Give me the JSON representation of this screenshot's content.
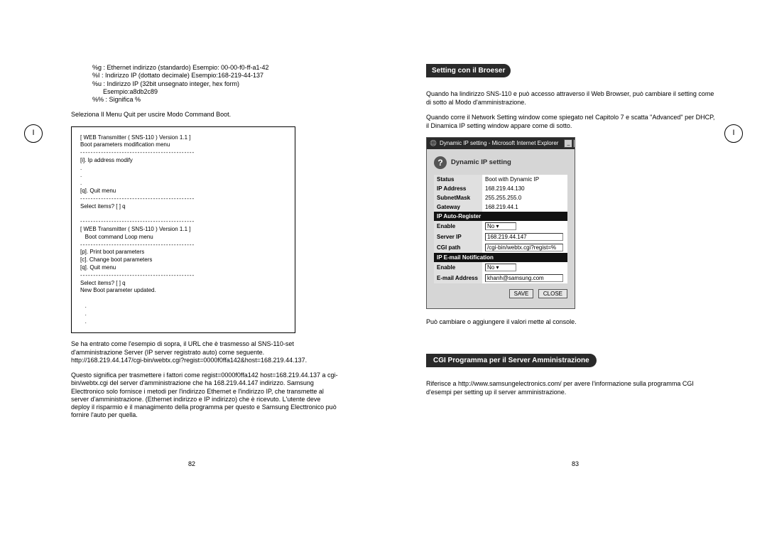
{
  "left": {
    "percent_lines": [
      "%g : Ethernet indirizzo (standardo) Esempio: 00-00-f0-ff-a1-42",
      "%I  : Indirizzo IP (dottato decimale) Esempio:168-219-44-137",
      "%u : Indirizzo IP (32bit unsegnato integer, hex form)",
      "      Esempio:a8db2c89",
      "%% : Significa %"
    ],
    "select_menu": "Seleziona Il Menu Quit per uscire Modo Command Boot.",
    "box": [
      "[ WEB Transmitter ( SNS-110 ) Version 1.1 ]",
      "Boot parameters modification menu",
      "--------------------------------------------",
      "[i]. Ip address modify",
      ".",
      ".",
      ".",
      "[q]. Quit menu",
      "--------------------------------------------",
      "Select items? [  ] q",
      "",
      "--------------------------------------------",
      "[ WEB Transmitter ( SNS-110 ) Version 1.1 ]",
      "   Boot command Loop menu",
      "--------------------------------------------",
      "[p]. Print boot parameters",
      "[c]. Change boot parameters",
      "[q]. Quit menu",
      "--------------------------------------------",
      "Select items? [  ] q",
      "New Boot parameter updated.",
      "",
      "   .",
      "   .",
      "   ."
    ],
    "p1": "Se ha entrato come l'esempio di sopra, il URL che è trasmesso al SNS-110-set d'amministrazione Server (IP server registrato auto) come seguente.",
    "p1b": "http://168.219.44.147/cgi-bin/webtx.cgi?regist=0000f0ffa142&host=168.219.44.137.",
    "p2": "Questo significa per trasmettere i fattori come regist=0000f0ffa142 host=168.219.44.137 a cgi-bin/webtx.cgi del server d'amministrazione che ha 168.219.44.147 indirizzo. Samsung Electtronico solo fornisce i metodi per l'indirizzo Ethernet e l'indirizzo IP, che transmette al server d'amministrazione. (Ethernet indirizzo e IP indirizzo) che è ricevuto. L'utente deve deploy il risparmio e il managimento della programma per questo e Samsung Electtronico può fornire l'auto per quella.",
    "pagenum": "82",
    "badge": "I"
  },
  "right": {
    "h1": "Setting con il Broeser",
    "r1": "Quando ha lindirizzo SNS-110 e può accesso attraverso il Web Browser, può cambiare il setting come di sotto al Modo d'amministrazione.",
    "r2": "Quando corre il Network Setting window come spiegato nel Capitolo 7 e scatta \"Advanced\" per DHCP, il Dinamica IP setting window appare come di sotto.",
    "win_title": "Dynamic IP setting - Microsoft Internet Explorer",
    "dyn_title": "Dynamic IP setting",
    "rows": {
      "status_l": "Status",
      "status_v": "Boot with Dynamic IP",
      "ip_l": "IP Address",
      "ip_v": "168.219.44.130",
      "mask_l": "SubnetMask",
      "mask_v": "255.255.255.0",
      "gw_l": "Gateway",
      "gw_v": "168.219.44.1",
      "sep1": "IP Auto-Register",
      "en1_l": "Enable",
      "en1_v": "No  ▾",
      "srv_l": "Server IP",
      "srv_v": "168.219.44.147",
      "cgi_l": "CGI path",
      "cgi_v": "/cgi-bin/webtx.cgi?regist=%",
      "sep2": "IP E-mail Notification",
      "en2_l": "Enable",
      "en2_v": "No  ▾",
      "em_l": "E-mail Address",
      "em_v": "khanh@samsung.com"
    },
    "save": "SAVE",
    "close": "CLOSE",
    "caption": "Può cambiare o aggiungere il valori mette al console.",
    "h2": "CGI Programma per il Server Amministrazione",
    "r3": "Riferisce a http://www.samsungelectronics.com/ per avere l'informazione sulla programma CGI d'esempi per setting up il server amministrazione.",
    "pagenum": "83",
    "badge": "I"
  }
}
